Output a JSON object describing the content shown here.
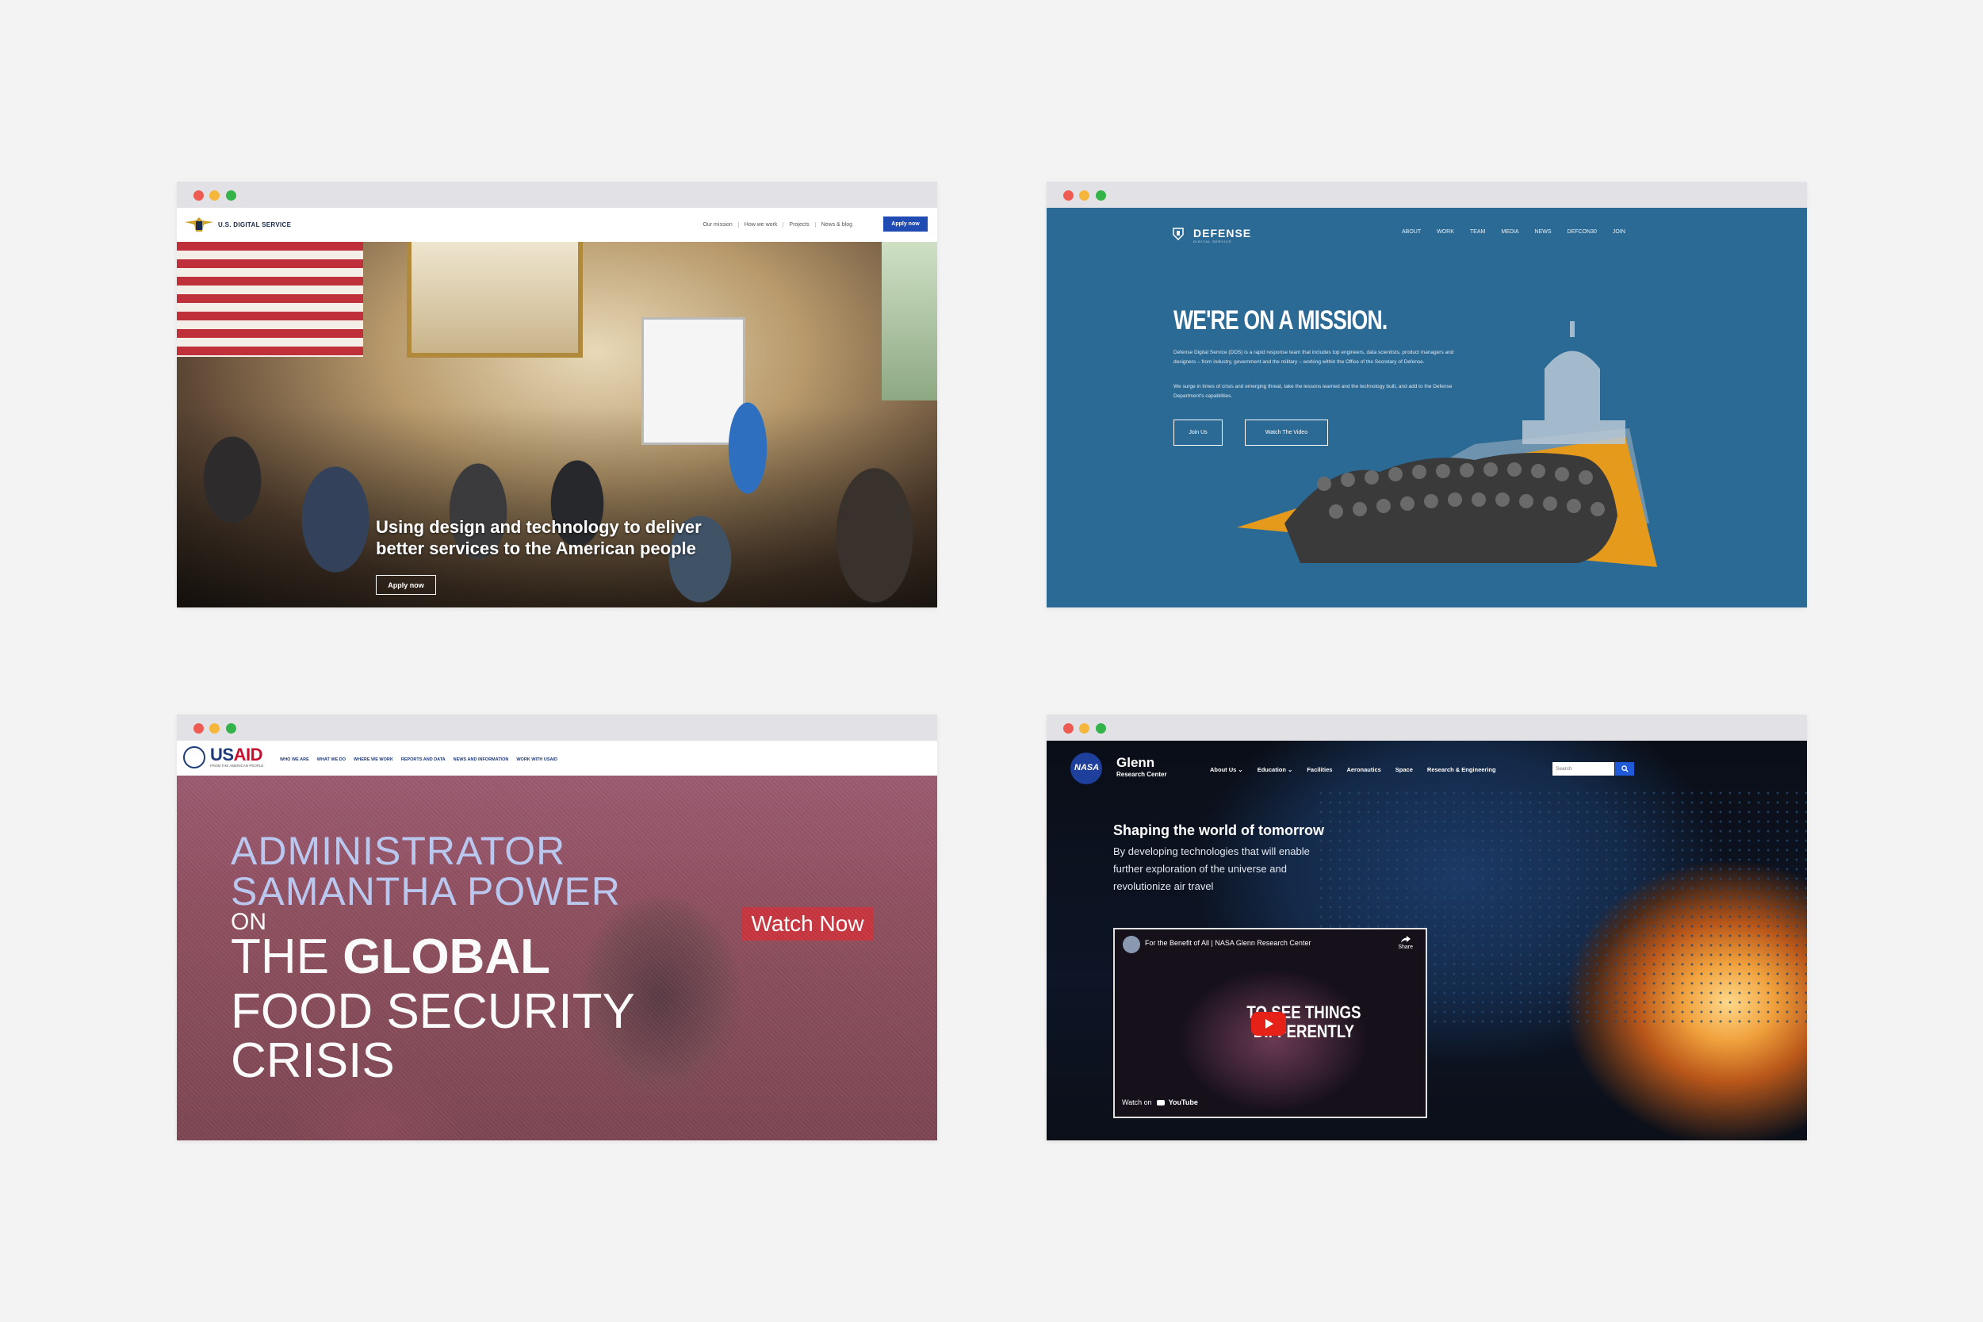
{
  "usds": {
    "brand": "U.S. DIGITAL SERVICE",
    "nav": [
      "Our mission",
      "How we work",
      "Projects",
      "News & blog"
    ],
    "apply_top": "Apply now",
    "headline": "Using design and technology to deliver better services to the American people",
    "apply_hero": "Apply now"
  },
  "dds": {
    "brand": "DEFENSE",
    "brand_sub": "DIGITAL SERVICE",
    "nav": [
      "ABOUT",
      "WORK",
      "TEAM",
      "MEDIA",
      "NEWS",
      "DEFCON30",
      "JOIN"
    ],
    "title": "WE'RE ON A MISSION.",
    "p1": "Defense Digital Service (DDS) is a rapid response team that includes top engineers, data scientists, product managers and designers – from industry, government and the military – working within the Office of the Secretary of Defense.",
    "p2": "We surge in times of crisis and emerging threat, take the lessons learned and the technology built, and add to the Defense Department's capabilities.",
    "join_button": "Join Us",
    "video_button": "Watch The Video"
  },
  "usaid": {
    "brand_us": "US",
    "brand_aid": "AID",
    "tagline": "FROM THE AMERICAN PEOPLE",
    "nav": [
      "WHO WE ARE",
      "WHAT WE DO",
      "WHERE WE WORK",
      "REPORTS AND DATA",
      "NEWS AND INFORMATION",
      "WORK WITH USAID"
    ],
    "line1": "ADMINISTRATOR",
    "line2": "SAMANTHA POWER",
    "line3": "ON",
    "line4a": "THE ",
    "line4b": "GLOBAL",
    "line5": "FOOD SECURITY",
    "line6": "CRISIS",
    "watch_now": "Watch Now"
  },
  "nasa": {
    "logo_text": "NASA",
    "brand": "Glenn",
    "brand_sub": "Research Center",
    "nav": [
      "About Us ⌄",
      "Education ⌄",
      "Facilities",
      "Aeronautics",
      "Space",
      "Research & Engineering"
    ],
    "search_placeholder": "Search",
    "headline": "Shaping the world of tomorrow",
    "paragraph": "By developing technologies that will enable further exploration of the universe and revolutionize air travel",
    "video_title": "For the Benefit of All | NASA Glenn Research Center",
    "video_share": "Share",
    "video_text": "TO SEE THINGS DIFFERENTLY",
    "watch_on": "Watch on",
    "youtube": "YouTube"
  },
  "colors": {
    "usds_apply": "#1f4bb3",
    "dds_bg": "#2c6a96",
    "dds_orange": "#e59a1c",
    "usaid_red": "#c8363f",
    "nasa_blue": "#1f5bd8",
    "traffic": [
      "#ee5b52",
      "#f5b73b",
      "#33b34a"
    ]
  }
}
